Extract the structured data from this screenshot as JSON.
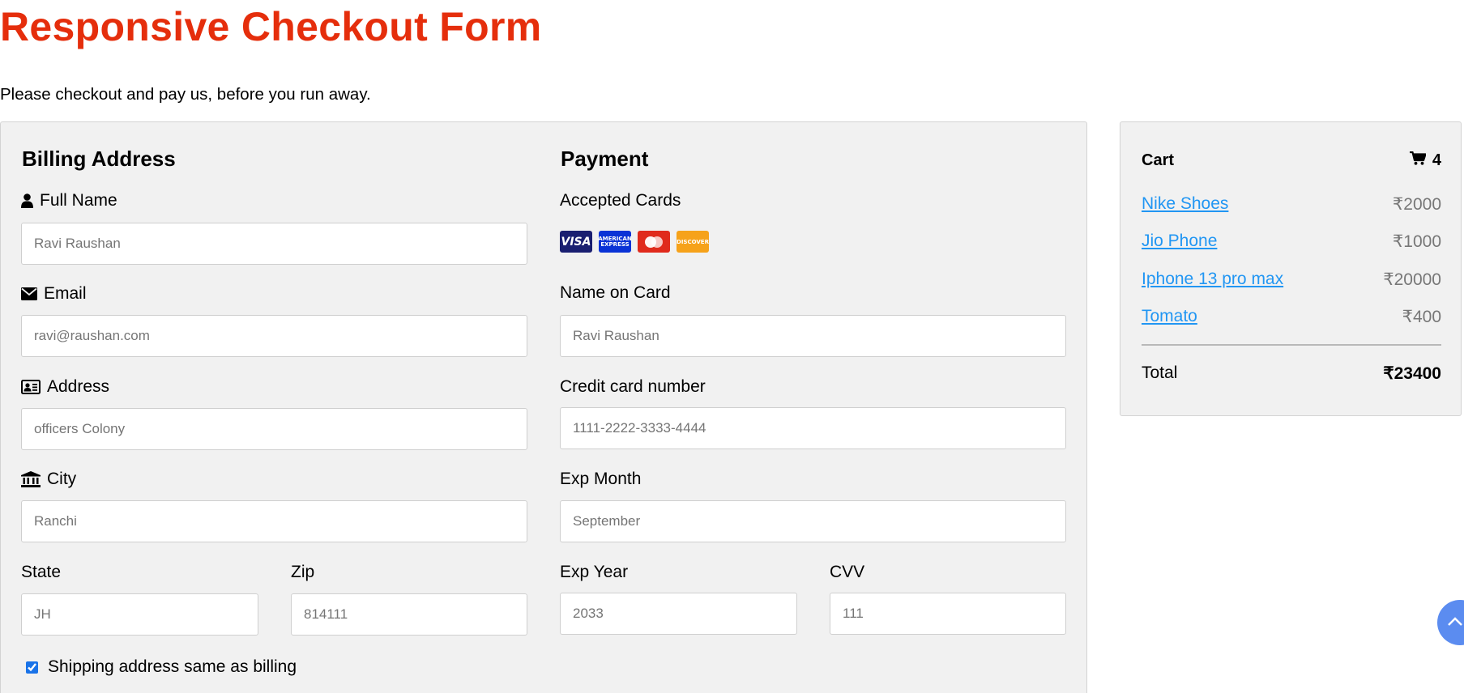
{
  "page": {
    "title": "Responsive Checkout Form",
    "subtitle": "Please checkout and pay us, before you run away."
  },
  "billing": {
    "heading": "Billing Address",
    "full_name": {
      "label": "Full Name",
      "placeholder": "Ravi Raushan",
      "icon": "user-icon"
    },
    "email": {
      "label": "Email",
      "placeholder": "ravi@raushan.com",
      "icon": "envelope-icon"
    },
    "address": {
      "label": "Address",
      "placeholder": "officers Colony",
      "icon": "address-card-icon"
    },
    "city": {
      "label": "City",
      "placeholder": "Ranchi",
      "icon": "institution-icon"
    },
    "state": {
      "label": "State",
      "placeholder": "JH"
    },
    "zip": {
      "label": "Zip",
      "placeholder": "814111"
    }
  },
  "payment": {
    "heading": "Payment",
    "accepted_cards_label": "Accepted Cards",
    "cards": {
      "visa": "VISA",
      "amex_line1": "AMERICAN",
      "amex_line2": "EXPRESS",
      "mastercard": "mastercard",
      "discover": "DISCOVER"
    },
    "name_on_card": {
      "label": "Name on Card",
      "placeholder": "Ravi Raushan"
    },
    "card_number": {
      "label": "Credit card number",
      "placeholder": "1111-2222-3333-4444"
    },
    "exp_month": {
      "label": "Exp Month",
      "placeholder": "September"
    },
    "exp_year": {
      "label": "Exp Year",
      "placeholder": "2033"
    },
    "cvv": {
      "label": "CVV",
      "placeholder": "111"
    }
  },
  "shipping_checkbox": {
    "label": "Shipping address same as billing",
    "checked": true
  },
  "cart": {
    "title": "Cart",
    "count": "4",
    "items": [
      {
        "name": "Nike Shoes",
        "price": "₹2000"
      },
      {
        "name": "Jio Phone",
        "price": "₹1000"
      },
      {
        "name": "Iphone 13 pro max",
        "price": "₹20000"
      },
      {
        "name": "Tomato",
        "price": "₹400"
      }
    ],
    "total_label": "Total",
    "total_value": "₹23400"
  },
  "colors": {
    "title": "#e52e0c",
    "link": "#2196f3",
    "panel_bg": "#f1f1f1",
    "scroll_button": "#5b8cf0"
  }
}
